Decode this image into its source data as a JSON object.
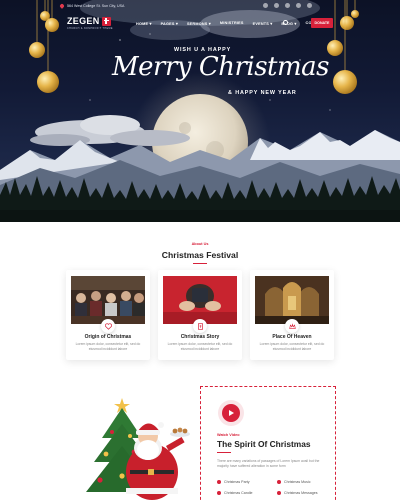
{
  "topbar": {
    "address": "564 West College St. Sun City, USA"
  },
  "brand": {
    "name": "ZEGEN",
    "tagline": "CHURCH & NONPROFIT THEME"
  },
  "nav": {
    "items": [
      "HOME ▾",
      "PAGES ▾",
      "SERMONS ▾",
      "MINISTRIES",
      "EVENTS ▾",
      "BLOG ▾",
      "CONTACT US"
    ],
    "donate_label": "DONATE"
  },
  "hero": {
    "pre_title": "WISH U A HAPPY",
    "title": "Merry Christmas",
    "post_title": "& HAPPY NEW YEAR"
  },
  "festival": {
    "kicker": "About Us",
    "title": "Christmas Festival",
    "cards": [
      {
        "title": "Origin of Christmas",
        "desc": "Lorem ipsum dolor, consectetur elit, sed do eiusmod incididunt labore"
      },
      {
        "title": "Christmas Story",
        "desc": "Lorem ipsum dolor, consectetur elit, sed do eiusmod incididunt labore"
      },
      {
        "title": "Place Of Heaven",
        "desc": "Lorem ipsum dolor, consectetur elit, sed do eiusmod incididunt labore"
      }
    ]
  },
  "video": {
    "kicker": "Watch Video",
    "title": "The Spirit Of Christmas",
    "desc": "There are many variations of passages of Lorem Ipsum avail but the majority have suffered alteration in some form",
    "list": [
      "Christmas Party",
      "Christmas Music",
      "Christmas Candle",
      "Christmas Messages"
    ]
  },
  "colors": {
    "accent": "#d7213a",
    "hero_bg": "#121a36",
    "ornament": "#e6b54a"
  }
}
